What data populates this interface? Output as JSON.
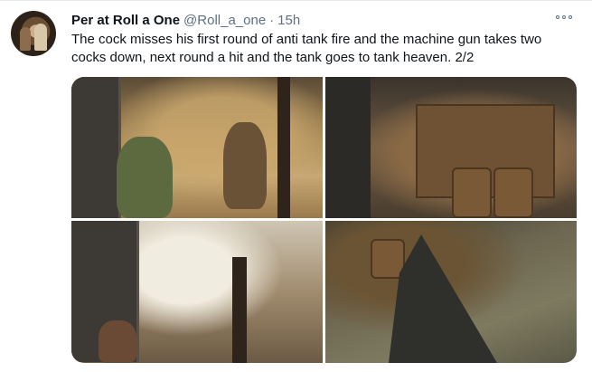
{
  "tweet": {
    "display_name": "Per at Roll a One",
    "handle": "@Roll_a_one",
    "separator": "·",
    "timestamp": "15h",
    "text": "The cock misses his first round of anti tank fire and the machine gun takes two cocks down, next round a hit and the tank goes to tank heaven. 2/2",
    "more_icon": "more-horizontal-icon"
  },
  "media": {
    "image_count": 4
  }
}
